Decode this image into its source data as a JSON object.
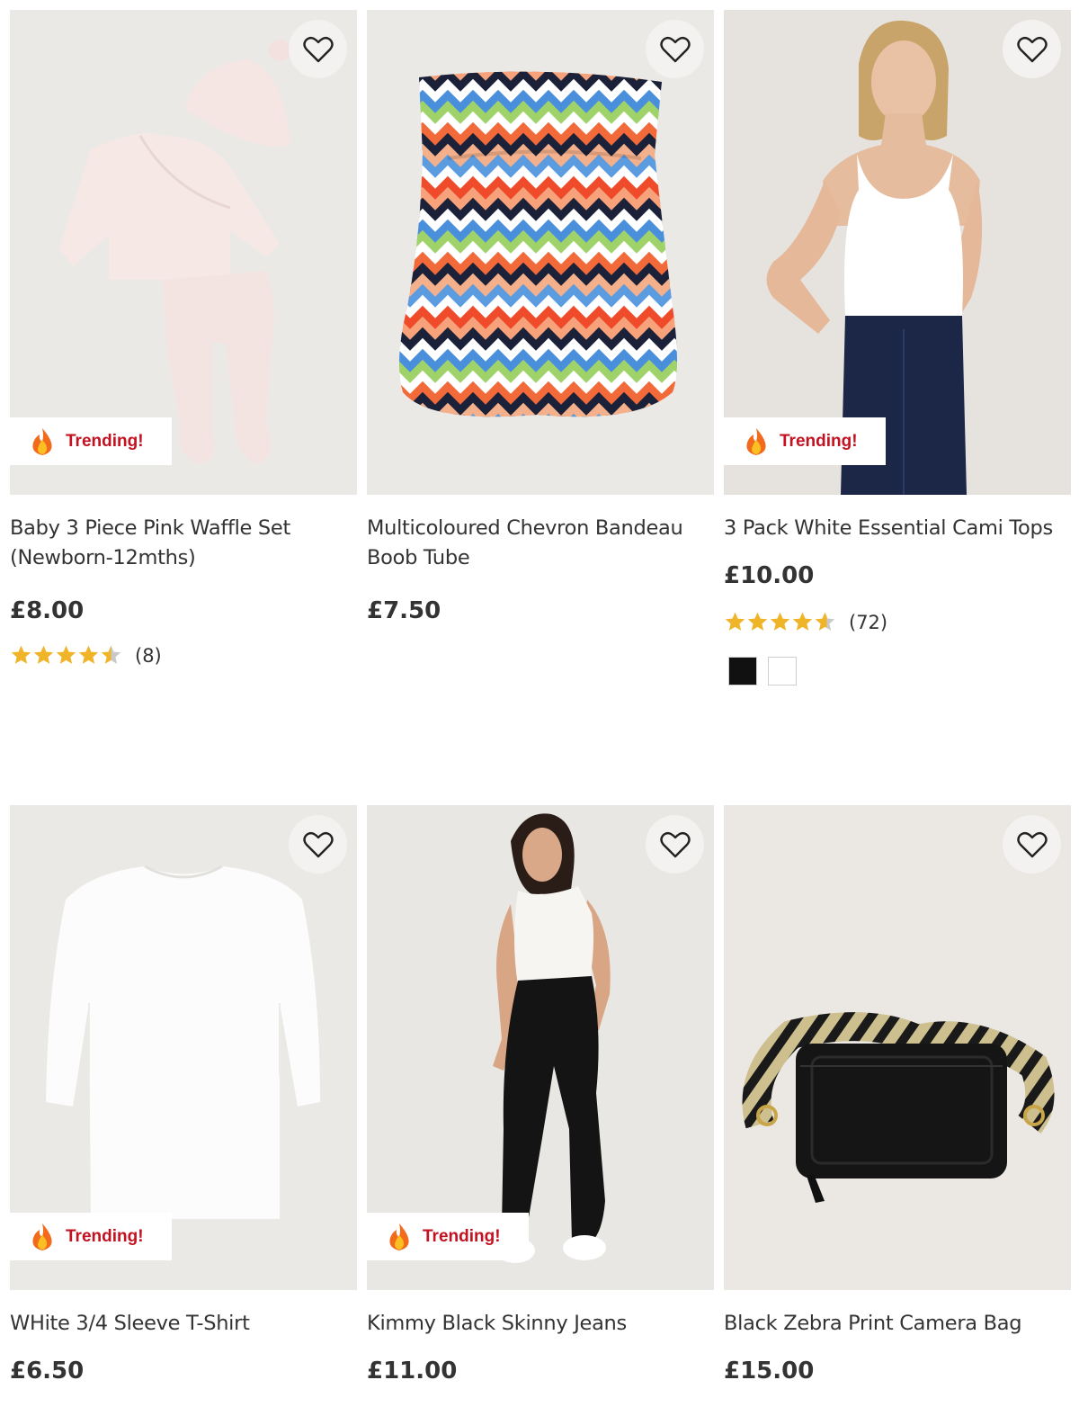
{
  "products": [
    {
      "title": "Baby 3 Piece Pink Waffle Set (Newborn-12mths)",
      "price": "£8.00",
      "badge": "Trending!",
      "rating": 4.5,
      "rating_count": "(8)",
      "wishlist_icon": "heart-outline-icon",
      "badge_icon": "fire-icon",
      "image_bg": "#ebe9e6"
    },
    {
      "title": "Multicoloured Chevron Bandeau Boob Tube",
      "price": "£7.50",
      "wishlist_icon": "heart-outline-icon",
      "image_bg": "#ebe9e6"
    },
    {
      "title": "3 Pack White Essential Cami Tops",
      "price": "£10.00",
      "badge": "Trending!",
      "rating": 4.6,
      "rating_count": "(72)",
      "swatches": [
        "#111111",
        "#ffffff"
      ],
      "wishlist_icon": "heart-outline-icon",
      "badge_icon": "fire-icon",
      "image_bg": "#e6e3df"
    },
    {
      "title": "WHite 3/4 Sleeve T-Shirt",
      "price": "£6.50",
      "badge": "Trending!",
      "wishlist_icon": "heart-outline-icon",
      "badge_icon": "fire-icon",
      "image_bg": "#ebe9e6"
    },
    {
      "title": "Kimmy Black Skinny Jeans",
      "price": "£11.00",
      "badge": "Trending!",
      "wishlist_icon": "heart-outline-icon",
      "badge_icon": "fire-icon",
      "image_bg": "#e9e7e3"
    },
    {
      "title": "Black Zebra Print Camera Bag",
      "price": "£15.00",
      "wishlist_icon": "heart-outline-icon",
      "image_bg": "#ebe8e4"
    }
  ],
  "colors": {
    "star": "#f0b429",
    "star_empty": "#c9c9c9",
    "badge_text": "#c41120",
    "price": "#333333"
  }
}
